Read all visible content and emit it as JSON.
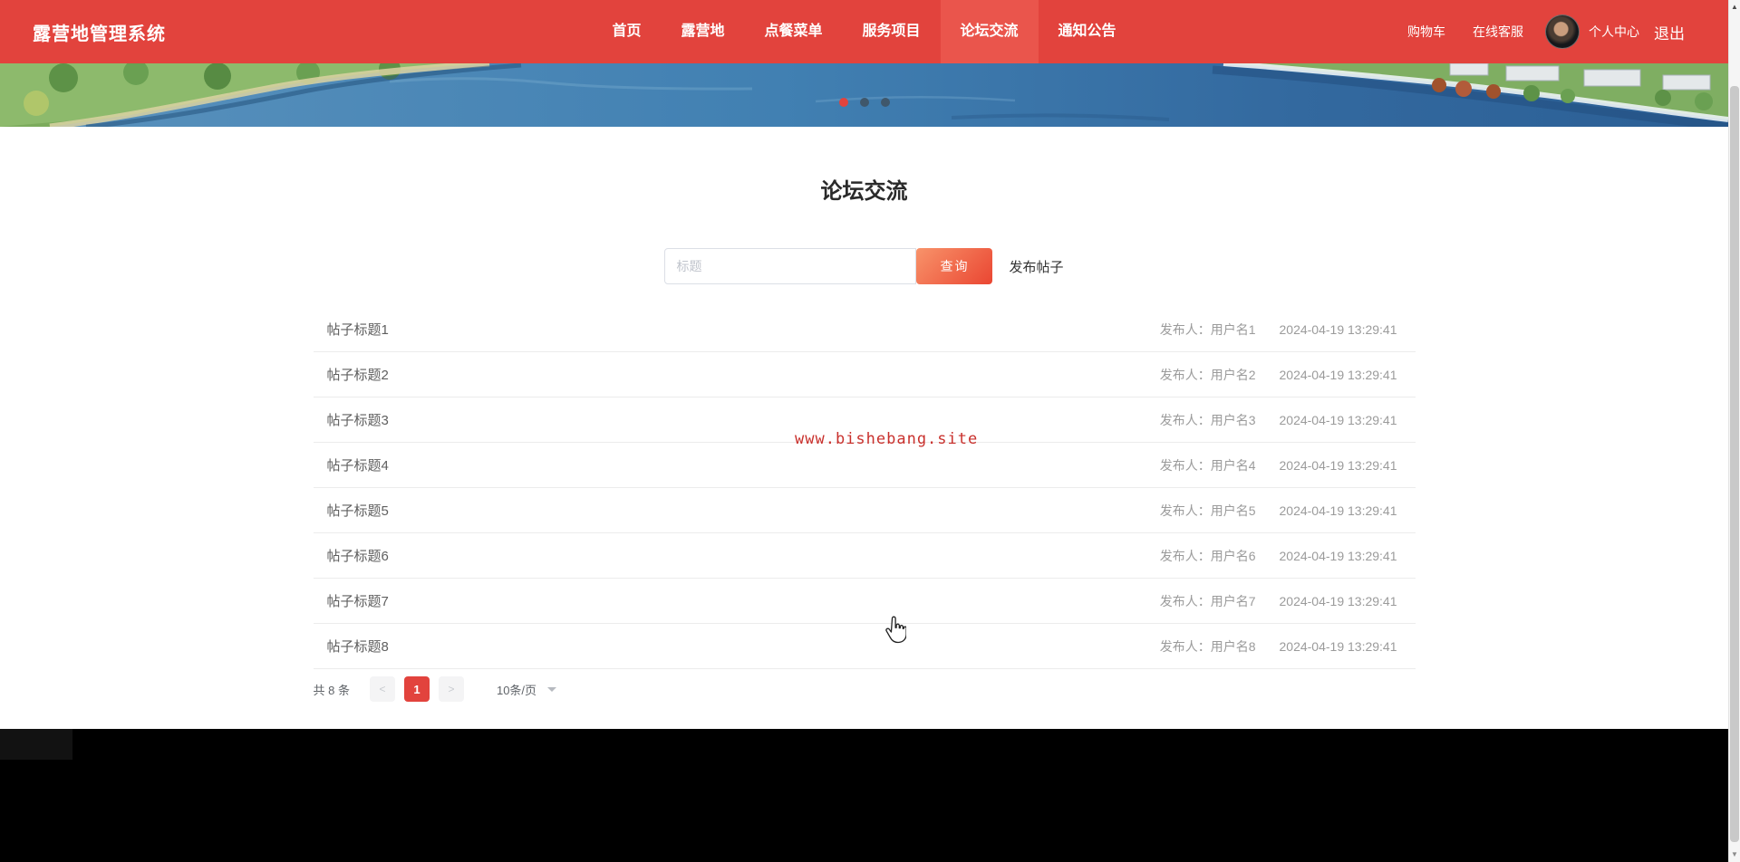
{
  "navbar": {
    "brand": "露营地管理系统",
    "items": [
      {
        "label": "首页",
        "active": false
      },
      {
        "label": "露营地",
        "active": false
      },
      {
        "label": "点餐菜单",
        "active": false
      },
      {
        "label": "服务项目",
        "active": false
      },
      {
        "label": "论坛交流",
        "active": true
      },
      {
        "label": "通知公告",
        "active": false
      }
    ],
    "right": {
      "cart": "购物车",
      "service": "在线客服",
      "profile": "个人中心",
      "logout": "退出"
    }
  },
  "banner": {
    "dot_count": 3,
    "active_index": 0
  },
  "forum": {
    "title": "论坛交流",
    "search": {
      "placeholder": "标题",
      "button": "查询"
    },
    "new_post": "发布帖子",
    "posts": [
      {
        "title": "帖子标题1",
        "publisher": "发布人：用户名1",
        "time": "2024-04-19 13:29:41"
      },
      {
        "title": "帖子标题2",
        "publisher": "发布人：用户名2",
        "time": "2024-04-19 13:29:41"
      },
      {
        "title": "帖子标题3",
        "publisher": "发布人：用户名3",
        "time": "2024-04-19 13:29:41"
      },
      {
        "title": "帖子标题4",
        "publisher": "发布人：用户名4",
        "time": "2024-04-19 13:29:41"
      },
      {
        "title": "帖子标题5",
        "publisher": "发布人：用户名5",
        "time": "2024-04-19 13:29:41"
      },
      {
        "title": "帖子标题6",
        "publisher": "发布人：用户名6",
        "time": "2024-04-19 13:29:41"
      },
      {
        "title": "帖子标题7",
        "publisher": "发布人：用户名7",
        "time": "2024-04-19 13:29:41"
      },
      {
        "title": "帖子标题8",
        "publisher": "发布人：用户名8",
        "time": "2024-04-19 13:29:41"
      }
    ]
  },
  "watermark": {
    "text": "www.bishebang.site"
  },
  "pagination": {
    "total": "共 8 条",
    "prev": "<",
    "current": "1",
    "next": ">",
    "page_size": "10条/页"
  },
  "colors": {
    "accent": "#e2433d",
    "navbar_active_bg": "#ea554c",
    "btn_grad_start": "#f8936a",
    "btn_grad_end": "#ea4632",
    "watermark_color": "#c9302c",
    "dot_inactive": "#3f576b"
  }
}
